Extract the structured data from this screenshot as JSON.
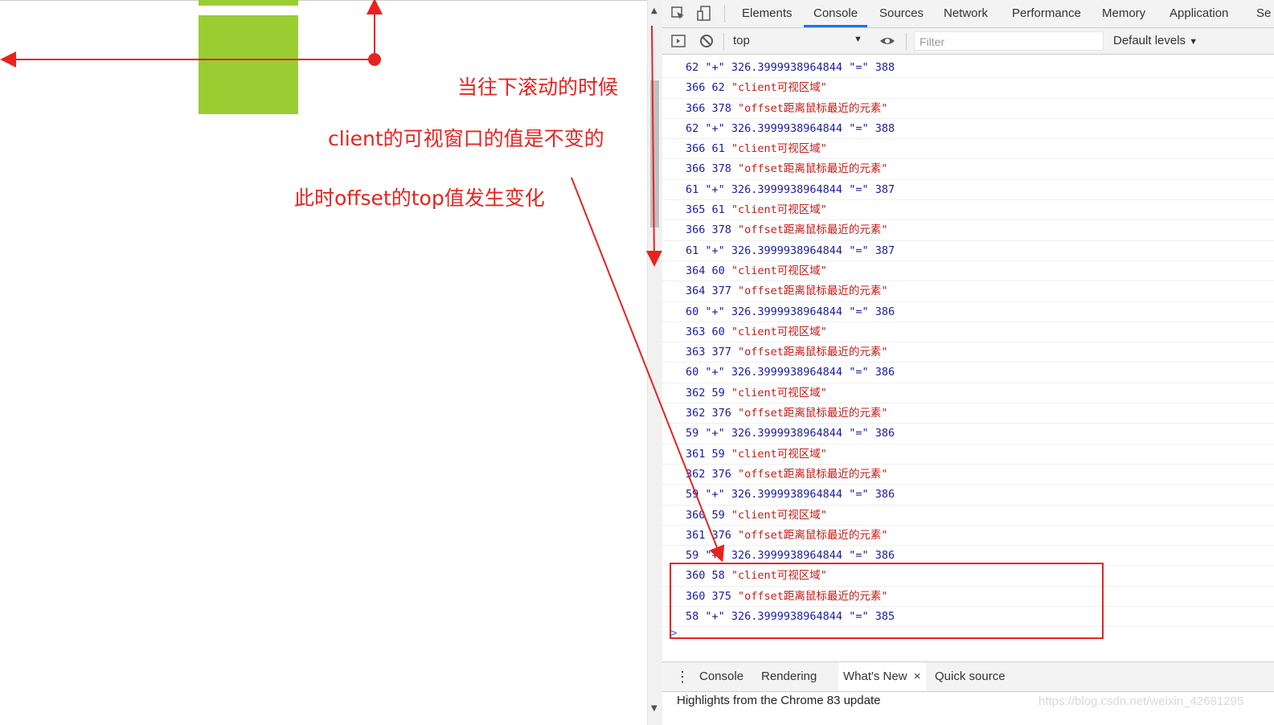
{
  "annotations": {
    "line1": "当往下滚动的时候",
    "line2": "client的可视窗口的值是不变的",
    "line3": "此时offset的top值发生变化"
  },
  "devtools": {
    "tabs": [
      "Elements",
      "Console",
      "Sources",
      "Network",
      "Performance",
      "Memory",
      "Application",
      "Se"
    ],
    "active_tab": "Console",
    "toolbar": {
      "context": "top",
      "filter_placeholder": "Filter",
      "levels": "Default levels"
    },
    "console_rows": [
      {
        "n": "62 \"+\" 326.3999938964844 \"=\" 388",
        "s": ""
      },
      {
        "n": "366 62 ",
        "s": "\"client可视区域\""
      },
      {
        "n": "366 378 ",
        "s": "\"offset距离鼠标最近的元素\""
      },
      {
        "n": "62 \"+\" 326.3999938964844 \"=\" 388",
        "s": ""
      },
      {
        "n": "366 61 ",
        "s": "\"client可视区域\""
      },
      {
        "n": "366 378 ",
        "s": "\"offset距离鼠标最近的元素\""
      },
      {
        "n": "61 \"+\" 326.3999938964844 \"=\" 387",
        "s": ""
      },
      {
        "n": "365 61 ",
        "s": "\"client可视区域\""
      },
      {
        "n": "366 378 ",
        "s": "\"offset距离鼠标最近的元素\""
      },
      {
        "n": "61 \"+\" 326.3999938964844 \"=\" 387",
        "s": ""
      },
      {
        "n": "364 60 ",
        "s": "\"client可视区域\""
      },
      {
        "n": "364 377 ",
        "s": "\"offset距离鼠标最近的元素\""
      },
      {
        "n": "60 \"+\" 326.3999938964844 \"=\" 386",
        "s": ""
      },
      {
        "n": "363 60 ",
        "s": "\"client可视区域\""
      },
      {
        "n": "363 377 ",
        "s": "\"offset距离鼠标最近的元素\""
      },
      {
        "n": "60 \"+\" 326.3999938964844 \"=\" 386",
        "s": ""
      },
      {
        "n": "362 59 ",
        "s": "\"client可视区域\""
      },
      {
        "n": "362 376 ",
        "s": "\"offset距离鼠标最近的元素\""
      },
      {
        "n": "59 \"+\" 326.3999938964844 \"=\" 386",
        "s": ""
      },
      {
        "n": "361 59 ",
        "s": "\"client可视区域\""
      },
      {
        "n": "362 376 ",
        "s": "\"offset距离鼠标最近的元素\""
      },
      {
        "n": "59 \"+\" 326.3999938964844 \"=\" 386",
        "s": ""
      },
      {
        "n": "360 59 ",
        "s": "\"client可视区域\""
      },
      {
        "n": "361 376 ",
        "s": "\"offset距离鼠标最近的元素\""
      },
      {
        "n": "59 \"+\" 326.3999938964844 \"=\" 386",
        "s": ""
      },
      {
        "n": "360 58 ",
        "s": "\"client可视区域\""
      },
      {
        "n": "360 375 ",
        "s": "\"offset距离鼠标最近的元素\""
      },
      {
        "n": "58 \"+\" 326.3999938964844 \"=\" 385",
        "s": ""
      }
    ],
    "prompt": ">",
    "drawer_tabs": [
      "Console",
      "Rendering",
      "What's New",
      "Quick source"
    ],
    "drawer_active": "What's New",
    "drawer_close": "×",
    "drawer_message": "Highlights from the Chrome 83 update"
  },
  "watermark": "https://blog.csdn.net/weixin_42681295",
  "colors": {
    "annotation_red": "#e8231f",
    "green_box": "#9acd32",
    "console_blue": "#1a1aa6",
    "console_string": "#c41a16",
    "tab_active": "#1a73e8"
  }
}
